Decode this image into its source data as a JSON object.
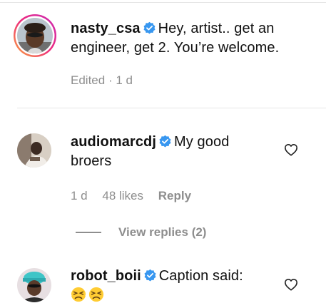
{
  "comments": [
    {
      "username": "nasty_csa",
      "text": "Hey, artist.. get an engineer, get 2. You’re welcome.",
      "edited_label": "Edited",
      "separator": "·",
      "time": "1 d",
      "verified": true,
      "has_story_ring": true
    },
    {
      "username": "audiomarcdj",
      "text_line1": "My good",
      "text_line2": "broers",
      "time": "1 d",
      "likes": "48 likes",
      "reply_label": "Reply",
      "verified": true,
      "view_replies": "View replies (2)"
    },
    {
      "username": "robot_boii",
      "text": "Caption said:",
      "emojis": [
        "persevering-face-emoji",
        "persevering-face-emoji"
      ],
      "verified": true
    }
  ],
  "colors": {
    "verified_blue": "#3897f0",
    "meta_gray": "#8e8e8e",
    "story_ring_start": "#f9a83d",
    "story_ring_end": "#c92bb7"
  },
  "icons": {
    "verified": "verified-badge-icon",
    "like": "heart-outline-icon"
  }
}
